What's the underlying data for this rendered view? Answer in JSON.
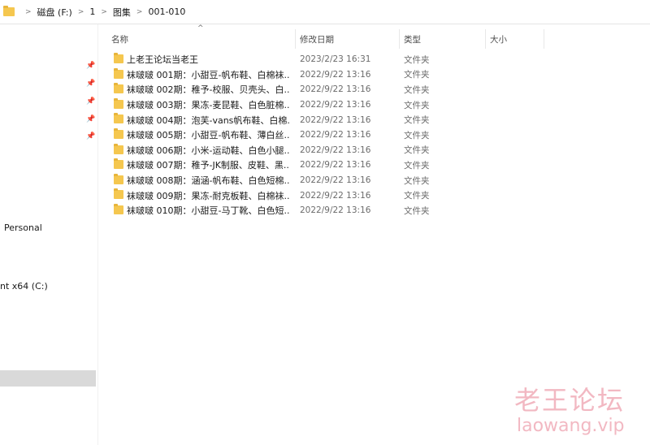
{
  "breadcrumb": [
    "磁盘 (F:)",
    "1",
    "图集",
    "001-010"
  ],
  "nav": {
    "personal_label": "Personal",
    "drive_label": "nt x64 (C:)"
  },
  "columns": {
    "name": "名称",
    "date": "修改日期",
    "type": "类型",
    "size": "大小"
  },
  "rows": [
    {
      "name": "上老王论坛当老王",
      "date": "2023/2/23 16:31",
      "type": "文件夹"
    },
    {
      "name": "袜啵啵 001期：小甜豆-帆布鞋、白棉袜...",
      "date": "2022/9/22 13:16",
      "type": "文件夹"
    },
    {
      "name": "袜啵啵 002期：稚予-校服、贝壳头、白...",
      "date": "2022/9/22 13:16",
      "type": "文件夹"
    },
    {
      "name": "袜啵啵 003期：果冻-麦昆鞋、白色脏棉...",
      "date": "2022/9/22 13:16",
      "type": "文件夹"
    },
    {
      "name": "袜啵啵 004期：泡芙-vans帆布鞋、白棉...",
      "date": "2022/9/22 13:16",
      "type": "文件夹"
    },
    {
      "name": "袜啵啵 005期：小甜豆-帆布鞋、薄白丝...",
      "date": "2022/9/22 13:16",
      "type": "文件夹"
    },
    {
      "name": "袜啵啵 006期：小米-运动鞋、白色小腿...",
      "date": "2022/9/22 13:16",
      "type": "文件夹"
    },
    {
      "name": "袜啵啵 007期：稚予-JK制服、皮鞋、黑...",
      "date": "2022/9/22 13:16",
      "type": "文件夹"
    },
    {
      "name": "袜啵啵 008期：涵涵-帆布鞋、白色短棉...",
      "date": "2022/9/22 13:16",
      "type": "文件夹"
    },
    {
      "name": "袜啵啵 009期：果冻-耐克板鞋、白棉袜...",
      "date": "2022/9/22 13:16",
      "type": "文件夹"
    },
    {
      "name": "袜啵啵 010期：小甜豆-马丁靴、白色短...",
      "date": "2022/9/22 13:16",
      "type": "文件夹"
    }
  ],
  "watermark": {
    "cn": "老王论坛",
    "en": "laowang.vip"
  }
}
